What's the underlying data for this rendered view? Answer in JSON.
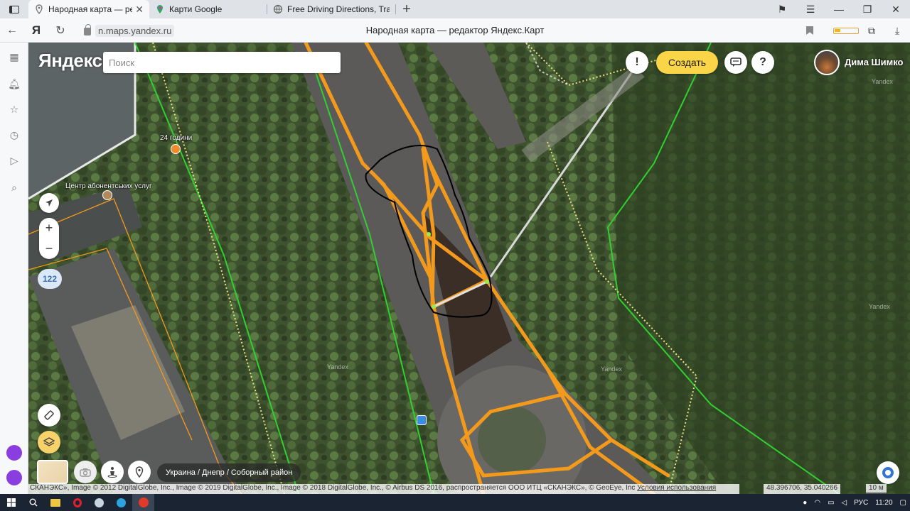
{
  "browser": {
    "tabs": [
      {
        "title": "Народная карта — редактор Яндекс.Карт",
        "icon": "map-pin-icon",
        "active": true
      },
      {
        "title": "Карти Google",
        "icon": "google-maps-icon",
        "active": false
      },
      {
        "title": "Free Driving Directions, Traffic Reports",
        "icon": "globe-icon",
        "active": false
      }
    ],
    "new_tab_label": "+",
    "url": "n.maps.yandex.ru",
    "page_title": "Народная карта — редактор Яндекс.Карт",
    "ya_button": "Я"
  },
  "map": {
    "logo": "Яндекс",
    "search": {
      "placeholder": "Поиск",
      "value": ""
    },
    "create_label": "Создать",
    "alert_label": "!",
    "help_label": "?",
    "user_name": "Дима Шимко",
    "zoom_in": "+",
    "zoom_out": "−",
    "counter": "122",
    "labels": {
      "poi_24h": "24 години",
      "poi_center": "Центр абонентських услуг"
    },
    "watermark": "Yandex",
    "breadcrumb": "Украина / Днепр / Соборный район",
    "copyright_text": "СКАНЭКС», Image © 2012 DigitalGlobe, Inc., Image © 2019 DigitalGlobe, Inc., Image © 2018 DigitalGlobe, Inc., © Airbus DS 2016, распространяется ООО ИТЦ «СКАНЭКС», © GeoEye, Inc",
    "terms_link": "Условия использования",
    "coordinates": "48.396706, 35.040266",
    "scale": "10 м"
  },
  "taskbar": {
    "language": "РУС",
    "time": "11:20"
  },
  "colors": {
    "road_orange": "#f39a1d",
    "boundary_green": "#2fd02f",
    "create_yellow": "#fbd548",
    "counter_blue": "#3a6fb0"
  }
}
